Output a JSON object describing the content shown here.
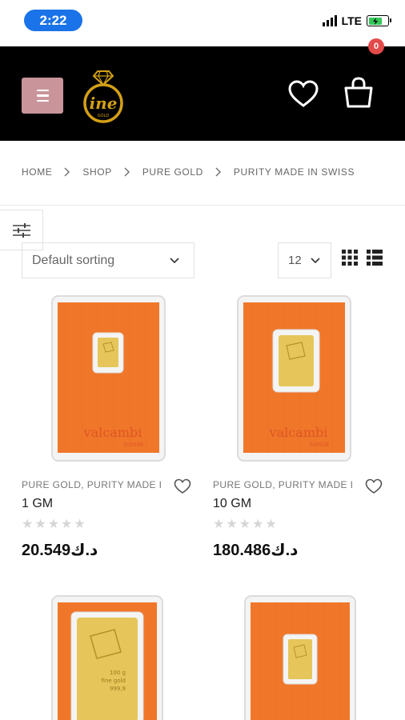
{
  "status_bar": {
    "time": "2:22",
    "network": "LTE"
  },
  "header": {
    "logo_name": "fine-gold-logo",
    "logo_text": "fine",
    "logo_subtext": "GOLD",
    "cart_count": "0",
    "brand_color": "#c9959b",
    "logo_color": "#d4a017"
  },
  "breadcrumb": [
    "HOME",
    "SHOP",
    "PURE GOLD",
    "PURITY MADE IN SWISS"
  ],
  "toolbar": {
    "sort_value": "Default sorting",
    "per_page_value": "12"
  },
  "products": [
    {
      "category": "PURE GOLD, PURITY MADE IN...",
      "name": "1 GM",
      "price": "20.549د.ك",
      "rating": 0,
      "package_brand": "valcambi",
      "package_sub": "SUISSE"
    },
    {
      "category": "PURE GOLD, PURITY MADE IN...",
      "name": "10 GM",
      "price": "180.486د.ك",
      "rating": 0,
      "package_brand": "valcambi",
      "package_sub": "SUISSE"
    },
    {
      "category": "",
      "name": "",
      "price": "",
      "rating": 0,
      "bar_text": "100 g fine gold 999,9"
    },
    {
      "category": "",
      "name": "",
      "price": "",
      "rating": 0
    }
  ],
  "colors": {
    "package_orange": "#f0772a",
    "gold": "#e6c65a",
    "badge_red": "#e34a4a",
    "time_pill": "#1a73e8"
  }
}
